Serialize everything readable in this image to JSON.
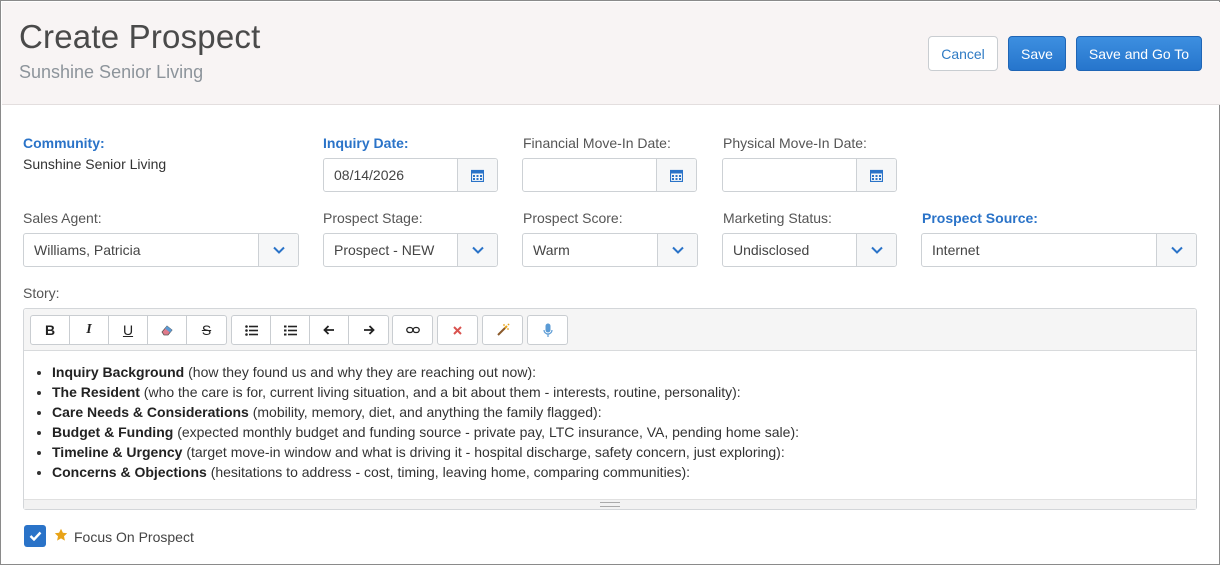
{
  "header": {
    "title": "Create Prospect",
    "subtitle": "Sunshine Senior Living",
    "cancel_label": "Cancel",
    "save_label": "Save",
    "save_go_label": "Save and Go To"
  },
  "fields": {
    "community_label": "Community:",
    "community_value": "Sunshine Senior Living",
    "inquiry_date_label": "Inquiry Date:",
    "inquiry_date_value": "08/14/2026",
    "financial_movein_label": "Financial Move-In Date:",
    "financial_movein_value": "",
    "physical_movein_label": "Physical Move-In Date:",
    "physical_movein_value": "",
    "sales_agent_label": "Sales Agent:",
    "sales_agent_value": "Williams, Patricia",
    "prospect_stage_label": "Prospect Stage:",
    "prospect_stage_value": "Prospect - NEW",
    "prospect_score_label": "Prospect Score:",
    "prospect_score_value": "Warm",
    "marketing_status_label": "Marketing Status:",
    "marketing_status_value": "Undisclosed",
    "prospect_source_label": "Prospect Source:",
    "prospect_source_value": "Internet"
  },
  "story": {
    "label": "Story:",
    "items": [
      {
        "heading": "Inquiry Background",
        "text": " (how they found us and why they are reaching out now):"
      },
      {
        "heading": "The Resident",
        "text": " (who the care is for, current living situation, and a bit about them - interests, routine, personality):"
      },
      {
        "heading": "Care Needs & Considerations",
        "text": " (mobility, memory, diet, and anything the family flagged):"
      },
      {
        "heading": "Budget & Funding",
        "text": " (expected monthly budget and funding source - private pay, LTC insurance, VA, pending home sale):"
      },
      {
        "heading": "Timeline & Urgency",
        "text": " (target move-in window and what is driving it - hospital discharge, safety concern, just exploring):"
      },
      {
        "heading": "Concerns & Objections",
        "text": " (hesitations to address - cost, timing, leaving home, comparing communities):"
      }
    ]
  },
  "toolbar": {
    "bold": "B",
    "italic": "I",
    "underline": "U",
    "strike": "S"
  },
  "focus": {
    "label": "Focus On Prospect",
    "checked": true
  },
  "colors": {
    "accent": "#2a73c8",
    "star": "#e8a317",
    "clear_format": "#d9534f"
  }
}
